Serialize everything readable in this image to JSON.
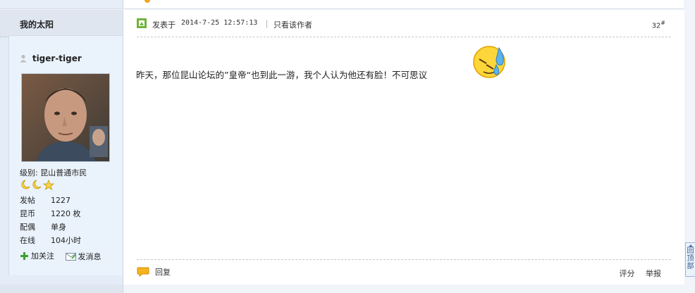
{
  "sidebar": {
    "board_name": "我的太阳",
    "username": "tiger-tiger",
    "level": "级别: 昆山普通市民",
    "stats": [
      {
        "label": "发帖",
        "value": "1227"
      },
      {
        "label": "昆币",
        "value": "1220 枚"
      },
      {
        "label": "配偶",
        "value": "单身"
      },
      {
        "label": "在线",
        "value": "104小时"
      }
    ],
    "actions": {
      "follow": "加关注",
      "message": "发消息"
    }
  },
  "post": {
    "posted_label": "发表于",
    "posted_date": "2014-7-25 12:57:13",
    "only_author": "只看该作者",
    "floor": "32",
    "floor_suffix": "#",
    "content": "昨天，那位昆山论坛的”皇帝“也到此一游，我个人认为他还有脸！不可思议",
    "reply": "回复",
    "rate": "评分",
    "report": "举报"
  },
  "back_to_top": "回顶部",
  "colors": {
    "accent_orange": "#f3a51f",
    "link_blue": "#34548a",
    "panel_blue": "#e3ecf7"
  }
}
